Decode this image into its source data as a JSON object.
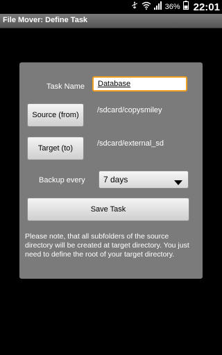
{
  "status_bar": {
    "battery_percent": "36%",
    "time": "22:01",
    "icons": [
      "usb-icon",
      "wifi-icon",
      "signal-icon",
      "battery-icon"
    ]
  },
  "app": {
    "title": "File Mover: Define Task"
  },
  "form": {
    "task_name_label": "Task Name",
    "task_name_value": "Database",
    "source_button": "Source (from)",
    "source_path": "/sdcard/copysmiley",
    "target_button": "Target (to)",
    "target_path": "/sdcard/external_sd",
    "backup_label": "Backup every",
    "backup_value": "7 days",
    "save_button": "Save Task",
    "note": "Please note, that all subfolders of the source directory will be created at target directory. You just need to define the root of your target directory."
  },
  "colors": {
    "dialog_bg": "#7b7b7b",
    "focus_border": "#f0a020"
  }
}
